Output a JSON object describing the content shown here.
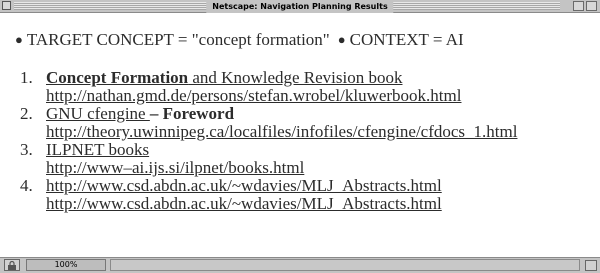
{
  "window": {
    "title": "Netscape: Navigation Planning Results"
  },
  "header": {
    "target_label": "TARGET CONCEPT = \"concept formation\"",
    "context_label": "CONTEXT = AI"
  },
  "results": [
    {
      "number": "1.",
      "title_bold": "Concept Formation",
      "title_rest": " and Knowledge Revision book",
      "url": "http://nathan.gmd.de/persons/stefan.wrobel/kluwerbook.html"
    },
    {
      "number": "2.",
      "title_plain": "GNU cfengine ",
      "title_bold": "– Foreword",
      "url": "http://theory.uwinnipeg.ca/localfiles/infofiles/cfengine/cfdocs_1.html"
    },
    {
      "number": "3.",
      "title": "ILPNET books",
      "url": "http://www–ai.ijs.si/ilpnet/books.html"
    },
    {
      "number": "4.",
      "title": "http://www.csd.abdn.ac.uk/~wdavies/MLJ_Abstracts.html",
      "url": "http://www.csd.abdn.ac.uk/~wdavies/MLJ_Abstracts.html"
    }
  ],
  "statusbar": {
    "progress_text": "100%",
    "lock_icon": "lock-icon"
  }
}
